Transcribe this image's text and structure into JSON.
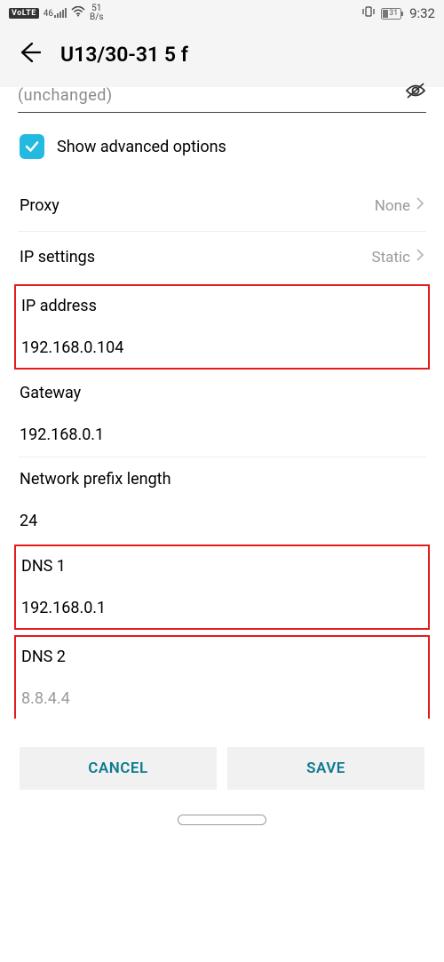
{
  "statusbar": {
    "volte": "VoLTE",
    "net": "46",
    "speed_top": "51",
    "speed_bot": "B/s",
    "battery": "31",
    "time": "9:32"
  },
  "header": {
    "title": "U13/30-31 5 f"
  },
  "password": {
    "partial": "(unchanged)"
  },
  "advanced": {
    "label": "Show advanced options"
  },
  "proxy": {
    "label": "Proxy",
    "value": "None"
  },
  "ipsettings": {
    "label": "IP settings",
    "value": "Static"
  },
  "ipaddress": {
    "label": "IP address",
    "value": "192.168.0.104"
  },
  "gateway": {
    "label": "Gateway",
    "value": "192.168.0.1"
  },
  "prefix": {
    "label": "Network prefix length",
    "value": "24"
  },
  "dns1": {
    "label": "DNS 1",
    "value": "192.168.0.1"
  },
  "dns2": {
    "label": "DNS 2",
    "placeholder": "8.8.4.4"
  },
  "buttons": {
    "cancel": "CANCEL",
    "save": "SAVE"
  }
}
